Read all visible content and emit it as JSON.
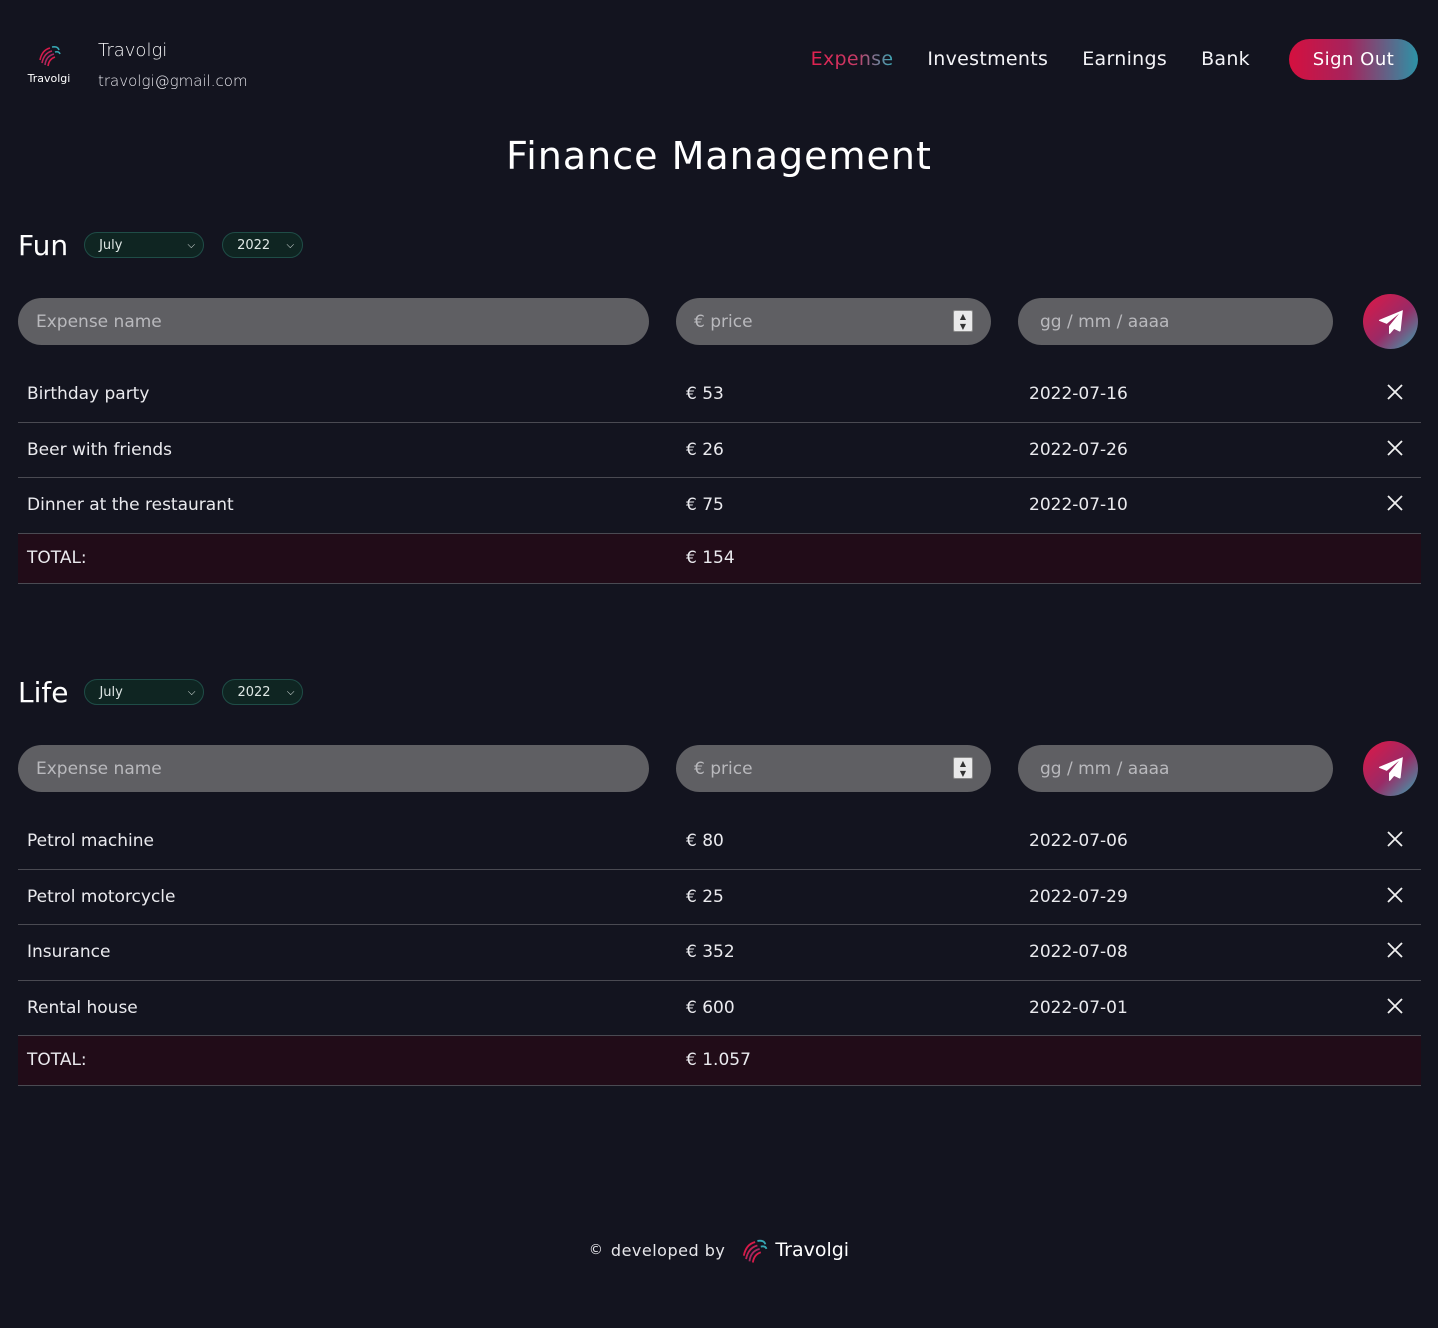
{
  "user": {
    "logo_label": "Travolgi",
    "name": "Travolgi",
    "email": "travolgi@gmail.com"
  },
  "nav": {
    "items": [
      "Expense",
      "Investments",
      "Earnings",
      "Bank"
    ],
    "active": "Expense",
    "signout": "Sign Out"
  },
  "title": "Finance Management",
  "form": {
    "name_placeholder": "Expense name",
    "price_placeholder": "€ price",
    "date_placeholder": "gg / mm / aaaa"
  },
  "sections": [
    {
      "title": "Fun",
      "month": "July",
      "year": "2022",
      "rows": [
        {
          "name": "Birthday party",
          "price": "€ 53",
          "date": "2022-07-16"
        },
        {
          "name": "Beer with friends",
          "price": "€ 26",
          "date": "2022-07-26"
        },
        {
          "name": "Dinner at the restaurant",
          "price": "€ 75",
          "date": "2022-07-10"
        }
      ],
      "total_label": "TOTAL:",
      "total": "€ 154"
    },
    {
      "title": "Life",
      "month": "July",
      "year": "2022",
      "rows": [
        {
          "name": "Petrol machine",
          "price": "€ 80",
          "date": "2022-07-06"
        },
        {
          "name": "Petrol motorcycle",
          "price": "€ 25",
          "date": "2022-07-29"
        },
        {
          "name": "Insurance",
          "price": "€ 352",
          "date": "2022-07-08"
        },
        {
          "name": "Rental house",
          "price": "€ 600",
          "date": "2022-07-01"
        }
      ],
      "total_label": "TOTAL:",
      "total": "€ 1.057"
    }
  ],
  "footer": {
    "copyright": "©",
    "developed_by": "developed by",
    "brand": "Travolgi"
  },
  "colors": {
    "background": "#13141f",
    "accent_red": "#e01745",
    "accent_teal": "#36a7b3",
    "total_row": "#210c18"
  },
  "icons": {
    "send": "paper-plane-icon",
    "delete": "close-icon",
    "select": "chevron-down-icon",
    "logo": "fingerprint-logo-icon"
  }
}
